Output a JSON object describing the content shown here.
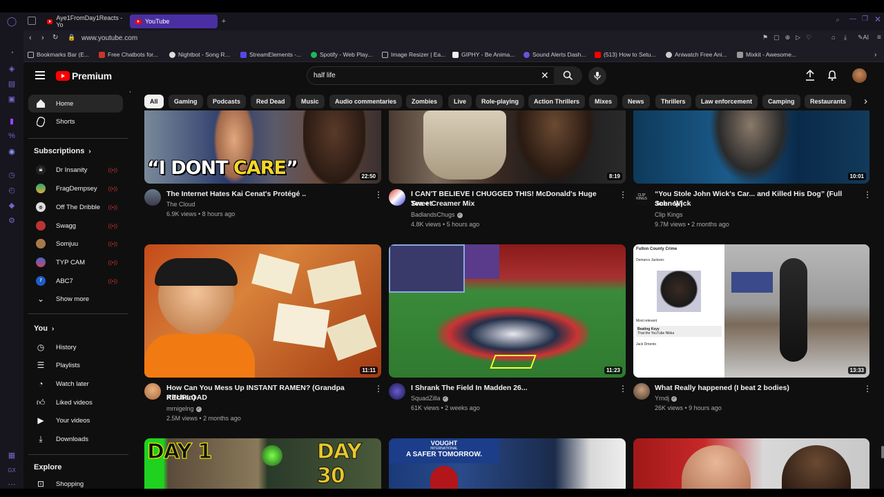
{
  "browser": {
    "tabs": [
      {
        "label": "Aye1FromDay1Reacts - Yo"
      },
      {
        "label": "YouTube"
      }
    ],
    "url": "www.youtube.com",
    "ai_label": "AI",
    "bookmarks": [
      "Bookmarks Bar (E...",
      "Free Chatbots for...",
      "Nightbot - Song R...",
      "StreamElements -...",
      "Spotify - Web Play...",
      "Image Resizer | Ea...",
      "GIPHY - Be Anima...",
      "Sound Alerts Dash...",
      "(513) How to Setu...",
      "Aniwatch Free Ani...",
      "Mixkit - Awesome..."
    ]
  },
  "header": {
    "logo_text": "Premium",
    "search_value": "half life"
  },
  "sidebar": {
    "main": [
      {
        "label": "Home"
      },
      {
        "label": "Shorts"
      }
    ],
    "subscriptions_title": "Subscriptions",
    "subscriptions": [
      {
        "label": "Dr Insanity"
      },
      {
        "label": "FragDempsey"
      },
      {
        "label": "Off The Dribble"
      },
      {
        "label": "Swagg"
      },
      {
        "label": "Somjuu"
      },
      {
        "label": "TYP CAM"
      },
      {
        "label": "ABC7"
      }
    ],
    "show_more": "Show more",
    "you_title": "You",
    "you_items": [
      {
        "label": "History"
      },
      {
        "label": "Playlists"
      },
      {
        "label": "Watch later"
      },
      {
        "label": "Liked videos"
      },
      {
        "label": "Your videos"
      },
      {
        "label": "Downloads"
      }
    ],
    "explore_title": "Explore",
    "explore_items": [
      {
        "label": "Shopping"
      }
    ]
  },
  "chips": [
    "All",
    "Gaming",
    "Podcasts",
    "Red Dead",
    "Music",
    "Audio commentaries",
    "Zombies",
    "Live",
    "Role-playing",
    "Action Thrillers",
    "Mixes",
    "News",
    "Thrillers",
    "Law enforcement",
    "Camping",
    "Restaurants"
  ],
  "videos": [
    {
      "title": "The Internet Hates Kai Cenat's Protégé ..",
      "title2": "",
      "channel": "The Cloud",
      "verified": false,
      "meta": "6.9K views • 8 hours ago",
      "duration": "22:50",
      "overlay_text_1": "“I DONT ",
      "overlay_text_2": "CARE",
      "overlay_text_3": "”"
    },
    {
      "title": "I CAN'T BELIEVE I CHUGGED THIS! McDonald's Huge Sweet",
      "title2": "Tea + Creamer Mix",
      "channel": "BadlandsChugs",
      "verified": true,
      "meta": "4.8K views • 5 hours ago",
      "duration": "8:19"
    },
    {
      "title": "“You Stole John Wick's Car... and Killed His Dog” (Full Scene) |",
      "title2": "John Wick",
      "channel": "Clip Kings",
      "verified": false,
      "meta": "9.7M views • 2 months ago",
      "duration": "10:01",
      "avatar_text": "CLIP KINGS"
    },
    {
      "title": "How Can You Mess Up INSTANT RAMEN? (Grandpa Kitchen) -",
      "title2": "REUPLOAD",
      "channel": "mrnigelng",
      "verified": true,
      "meta": "2.5M views • 2 months ago",
      "duration": "11:11"
    },
    {
      "title": "I Shrank The Field In Madden 26...",
      "title2": "",
      "channel": "SquadZilla",
      "verified": true,
      "meta": "61K views • 2 weeks ago",
      "duration": "11:23"
    },
    {
      "title": "What Really happened (I beat 2 bodies)",
      "title2": "",
      "channel": "Yrndj",
      "verified": true,
      "meta": "26K views • 9 hours ago",
      "duration": "13:33"
    }
  ],
  "thumb_texts": {
    "fb_post_title": "Fulton County Crime",
    "fb_post_body": "Demarco Jackson:",
    "fb_most_relevant": "Most relevant",
    "fb_commenter_1": "Beating Keyy",
    "fb_comment_1": "That the YouTube Nikka",
    "fb_commenter_2": "Jack Dmento",
    "day1": "DAY 1",
    "day30": "DAY 30",
    "vought_1": "VOUGHT",
    "vought_2": "INTERNATIONAL",
    "vought_3": "A SAFER TOMORROW."
  }
}
